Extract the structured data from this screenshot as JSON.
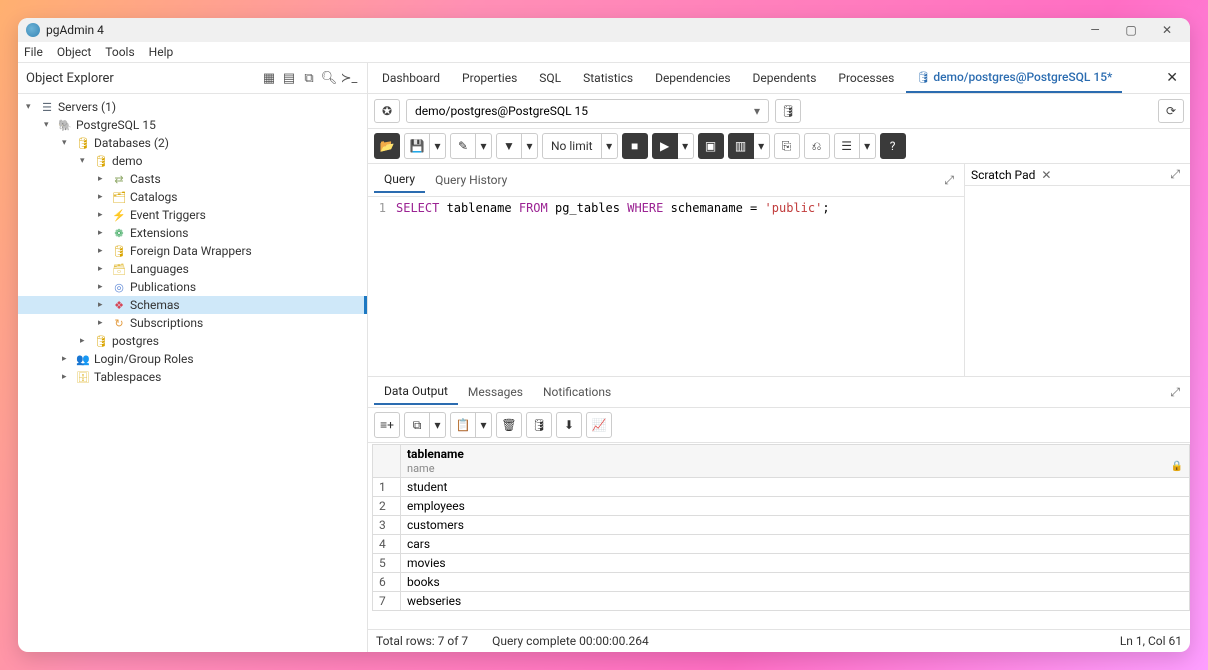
{
  "window": {
    "title": "pgAdmin 4"
  },
  "menu": {
    "file": "File",
    "object": "Object",
    "tools": "Tools",
    "help": "Help"
  },
  "explorer": {
    "title": "Object Explorer"
  },
  "tree": {
    "servers": "Servers (1)",
    "pg": "PostgreSQL 15",
    "databases": "Databases (2)",
    "demo": "demo",
    "casts": "Casts",
    "catalogs": "Catalogs",
    "event_triggers": "Event Triggers",
    "extensions": "Extensions",
    "fdw": "Foreign Data Wrappers",
    "languages": "Languages",
    "publications": "Publications",
    "schemas": "Schemas",
    "subscriptions": "Subscriptions",
    "postgres": "postgres",
    "roles": "Login/Group Roles",
    "tablespaces": "Tablespaces"
  },
  "tabs": {
    "dashboard": "Dashboard",
    "properties": "Properties",
    "sql": "SQL",
    "statistics": "Statistics",
    "dependencies": "Dependencies",
    "dependents": "Dependents",
    "processes": "Processes",
    "querytool": "demo/postgres@PostgreSQL 15*"
  },
  "connection": {
    "label": "demo/postgres@PostgreSQL 15"
  },
  "toolbar": {
    "nolimit": "No limit"
  },
  "editor": {
    "query_tab": "Query",
    "history_tab": "Query History",
    "line_no": "1",
    "sql": {
      "select": "SELECT",
      "col": " tablename ",
      "from": "FROM",
      "tbl": " pg_tables ",
      "where": "WHERE",
      "cond": " schemaname = ",
      "val": "'public'",
      "end": ";"
    }
  },
  "scratch": {
    "title": "Scratch Pad"
  },
  "output": {
    "tabs": {
      "data": "Data Output",
      "messages": "Messages",
      "notifications": "Notifications"
    },
    "column": {
      "name": "tablename",
      "type": "name"
    },
    "rows": [
      "student",
      "employees",
      "customers",
      "cars",
      "movies",
      "books",
      "webseries"
    ]
  },
  "status": {
    "rows": "Total rows: 7 of 7",
    "complete": "Query complete 00:00:00.264",
    "cursor": "Ln 1, Col 61"
  }
}
